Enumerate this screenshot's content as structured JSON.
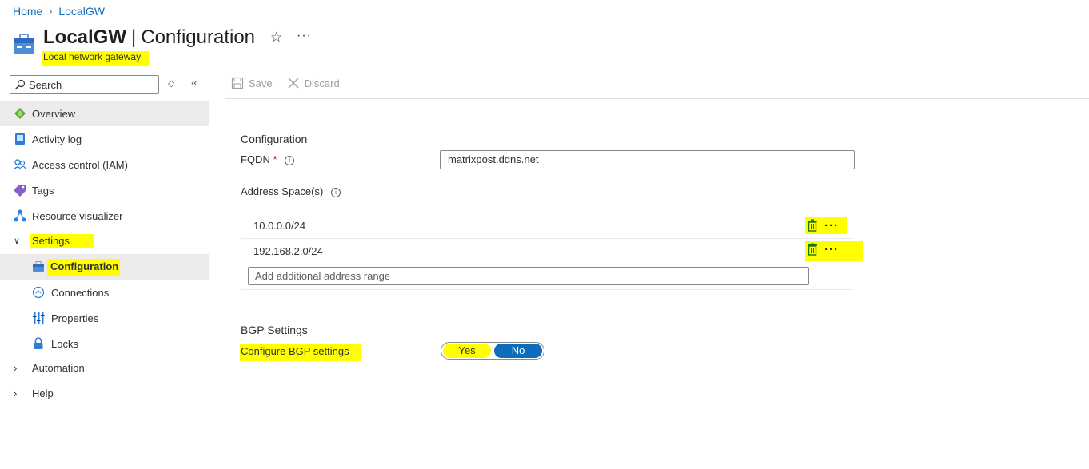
{
  "breadcrumb": {
    "home": "Home",
    "current": "LocalGW"
  },
  "header": {
    "resource_name": "LocalGW",
    "separator": "|",
    "blade": "Configuration",
    "subtitle": "Local network gateway"
  },
  "search": {
    "placeholder": "Search"
  },
  "toolbar": {
    "save": "Save",
    "discard": "Discard"
  },
  "nav": {
    "overview": "Overview",
    "activity_log": "Activity log",
    "access_control": "Access control (IAM)",
    "tags": "Tags",
    "resource_visualizer": "Resource visualizer",
    "settings": "Settings",
    "configuration": "Configuration",
    "connections": "Connections",
    "properties": "Properties",
    "locks": "Locks",
    "automation": "Automation",
    "help": "Help"
  },
  "configuration": {
    "section_title": "Configuration",
    "fqdn_label": "FQDN",
    "required_marker": "*",
    "fqdn_value": "matrixpost.ddns.net",
    "address_space_label": "Address Space(s)",
    "address_spaces": [
      "10.0.0.0/24",
      "192.168.2.0/24"
    ],
    "add_range_placeholder": "Add additional address range"
  },
  "bgp": {
    "section_title": "BGP Settings",
    "configure_label": "Configure BGP settings",
    "yes": "Yes",
    "no": "No",
    "selected": "No"
  },
  "colors": {
    "accent": "#0f6cbd",
    "highlight": "#ffff00",
    "selected_nav": "#edebe9"
  }
}
